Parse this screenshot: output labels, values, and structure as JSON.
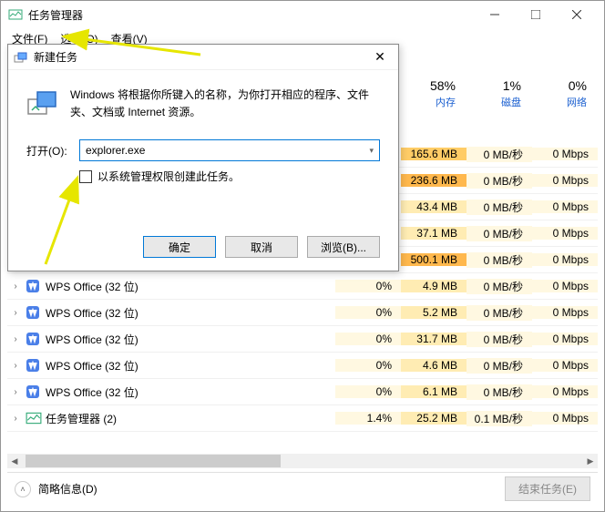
{
  "taskmgr": {
    "title": "任务管理器",
    "menu": {
      "file": "文件(F)",
      "options": "选项(O)",
      "view": "查看(V)"
    },
    "columns": {
      "mem": {
        "pct": "58%",
        "label": "内存"
      },
      "disk": {
        "pct": "1%",
        "label": "磁盘"
      },
      "net": {
        "pct": "0%",
        "label": "网络"
      }
    },
    "rows": [
      {
        "name": "",
        "cpu": "",
        "mem": "165.6 MB",
        "mem_heat": "hot",
        "disk": "0 MB/秒",
        "net": "0 Mbps",
        "hidden": true
      },
      {
        "name": "",
        "cpu": "",
        "mem": "236.6 MB",
        "mem_heat": "veryhot",
        "disk": "0 MB/秒",
        "net": "0 Mbps",
        "hidden": true
      },
      {
        "name": "",
        "cpu": "",
        "mem": "43.4 MB",
        "mem_heat": "",
        "disk": "0 MB/秒",
        "net": "0 Mbps",
        "hidden": true
      },
      {
        "name": "",
        "cpu": "",
        "mem": "37.1 MB",
        "mem_heat": "",
        "disk": "0 MB/秒",
        "net": "0 Mbps",
        "hidden": true
      },
      {
        "name": "",
        "cpu": "",
        "mem": "500.1 MB",
        "mem_heat": "veryhot",
        "disk": "0 MB/秒",
        "net": "0 Mbps",
        "hidden": true
      },
      {
        "name": "WPS Office (32 位)",
        "cpu": "0%",
        "mem": "4.9 MB",
        "mem_heat": "",
        "disk": "0 MB/秒",
        "net": "0 Mbps",
        "icon": "wps"
      },
      {
        "name": "WPS Office (32 位)",
        "cpu": "0%",
        "mem": "5.2 MB",
        "mem_heat": "",
        "disk": "0 MB/秒",
        "net": "0 Mbps",
        "icon": "wps"
      },
      {
        "name": "WPS Office (32 位)",
        "cpu": "0%",
        "mem": "31.7 MB",
        "mem_heat": "",
        "disk": "0 MB/秒",
        "net": "0 Mbps",
        "icon": "wps"
      },
      {
        "name": "WPS Office (32 位)",
        "cpu": "0%",
        "mem": "4.6 MB",
        "mem_heat": "",
        "disk": "0 MB/秒",
        "net": "0 Mbps",
        "icon": "wps"
      },
      {
        "name": "WPS Office (32 位)",
        "cpu": "0%",
        "mem": "6.1 MB",
        "mem_heat": "",
        "disk": "0 MB/秒",
        "net": "0 Mbps",
        "icon": "wps"
      },
      {
        "name": "任务管理器 (2)",
        "cpu": "1.4%",
        "mem": "25.2 MB",
        "mem_heat": "",
        "disk": "0.1 MB/秒",
        "net": "0 Mbps",
        "icon": "taskmgr"
      }
    ],
    "footer": {
      "brief": "简略信息(D)",
      "endtask": "结束任务(E)"
    }
  },
  "dialog": {
    "title": "新建任务",
    "desc": "Windows 将根据你所键入的名称，为你打开相应的程序、文件夹、文档或 Internet 资源。",
    "open_label": "打开(O):",
    "input_value": "explorer.exe",
    "admin_check": "以系统管理权限创建此任务。",
    "ok": "确定",
    "cancel": "取消",
    "browse": "浏览(B)..."
  }
}
